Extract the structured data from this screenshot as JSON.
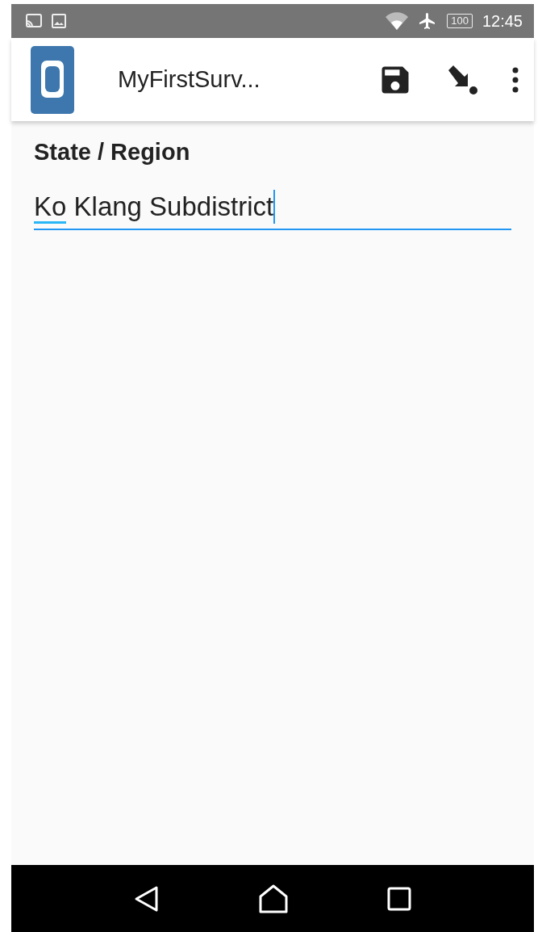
{
  "status_bar": {
    "battery": "100",
    "time": "12:45"
  },
  "app_bar": {
    "title": "MyFirstSurv..."
  },
  "question": {
    "label": "State / Region",
    "value": "Ko Klang Subdistrict",
    "focused": true
  }
}
